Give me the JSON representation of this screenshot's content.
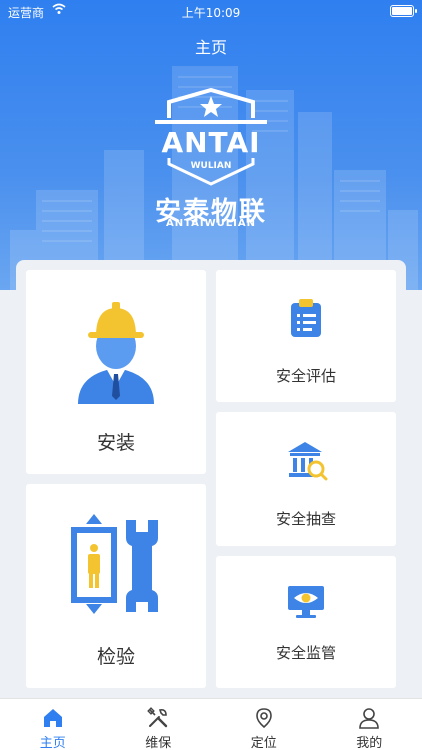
{
  "status_bar": {
    "carrier": "运营商",
    "time": "上午10:09"
  },
  "header": {
    "title": "主页"
  },
  "logo": {
    "word": "ANTAI",
    "sub": "WULIAN",
    "brand_cn": "安泰物联",
    "brand_en": "ANTAIWULIAN"
  },
  "cards": {
    "install": "安装",
    "inspect": "检验",
    "evaluate": "安全评估",
    "spot_check": "安全抽查",
    "supervise": "安全监管"
  },
  "tabs": [
    {
      "label": "主页",
      "icon": "home-icon",
      "active": true
    },
    {
      "label": "维保",
      "icon": "tools-icon",
      "active": false
    },
    {
      "label": "定位",
      "icon": "location-icon",
      "active": false
    },
    {
      "label": "我的",
      "icon": "user-icon",
      "active": false
    }
  ],
  "colors": {
    "primary": "#2f7ff0",
    "background": "#edf0f5",
    "accent_yellow": "#f4c430"
  }
}
